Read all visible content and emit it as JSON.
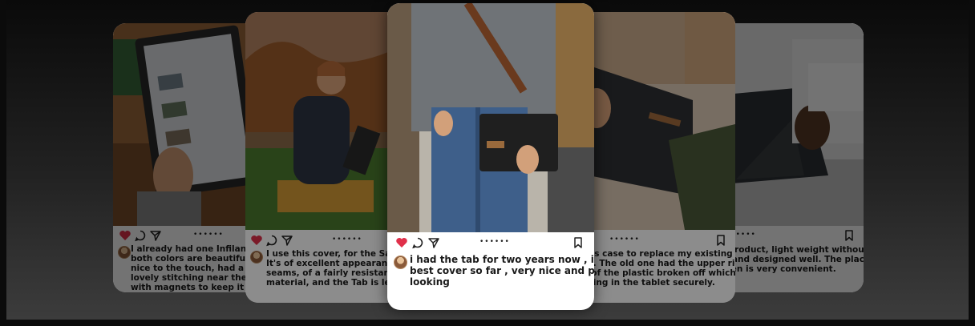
{
  "colors": {
    "heart": "#e0304a",
    "background": "#0b0b0b"
  },
  "icons": {
    "like": "heart-icon",
    "comment": "comment-icon",
    "share": "share-icon",
    "save": "bookmark-icon",
    "pager": "carousel-dots"
  },
  "pager_dots": "••••••",
  "cards": [
    {
      "id": "card-1",
      "comment": "I already had one Infiland case in\nboth colors are beautiful, the cas\nnice to the touch, had a cool text\nlovely stitching near the borders.\nwith magnets to keep it closed,"
    },
    {
      "id": "card-2",
      "comment": "I use this cover, for the Samsung\nIt's of excellent appearance, with\nseams, of a fairly resistant fabric\nmaterial, and the Tab is left with"
    },
    {
      "id": "card-3",
      "comment": "i had the tab for two years now , its the\nbest cover so far , very nice and professional\nlooking"
    },
    {
      "id": "card-4",
      "comment": "d this case to replace my existing one\nland. The old one had the upper right\nner of the plastic broken off which\nholding in the tablet securely."
    },
    {
      "id": "card-5",
      "comment": "ty product, light weight without\nsy, and designed well. The place\nS pen is very convenient."
    }
  ]
}
